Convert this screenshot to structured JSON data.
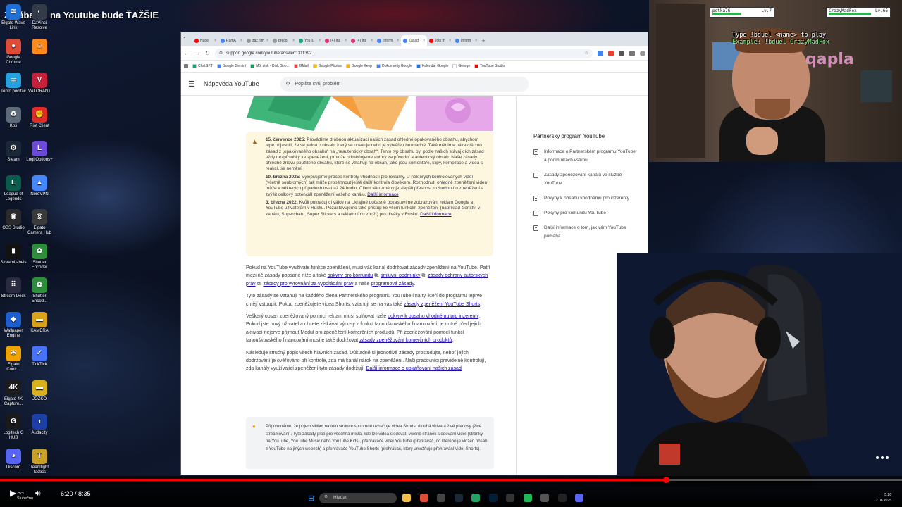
{
  "stream": {
    "title": "Zarábanie na Youtube bude ŤAŽŠIE"
  },
  "desktop_icons": [
    {
      "label": "Elgato Wave Link",
      "color": "#1e6fd6",
      "glyph": "≋"
    },
    {
      "label": "DaVinci Resolve",
      "color": "#333b48",
      "glyph": "◐"
    },
    {
      "label": "Google Chrome",
      "color": "#dd4b39",
      "glyph": "●"
    },
    {
      "label": "",
      "color": "#ff8a1c",
      "glyph": "☺"
    },
    {
      "label": "Tento počítač",
      "color": "#25a3e0",
      "glyph": "▭"
    },
    {
      "label": "VALORANT",
      "color": "#c81f3a",
      "glyph": "V"
    },
    {
      "label": "Koš",
      "color": "#5d6a7a",
      "glyph": "♻"
    },
    {
      "label": "Riot Client",
      "color": "#e02b2b",
      "glyph": "✊"
    },
    {
      "label": "Steam",
      "color": "#1b2838",
      "glyph": "⚙"
    },
    {
      "label": "Logi Options+",
      "color": "#6c4bd8",
      "glyph": "L"
    },
    {
      "label": "League of Legends",
      "color": "#0b5b4c",
      "glyph": "L"
    },
    {
      "label": "NordVPN",
      "color": "#4687ff",
      "glyph": "▲"
    },
    {
      "label": "OBS Studio",
      "color": "#2b2b2b",
      "glyph": "◉"
    },
    {
      "label": "Elgato Camera Hub",
      "color": "#3a3a3a",
      "glyph": "◎"
    },
    {
      "label": "StreamLabels",
      "color": "#121212",
      "glyph": "▮"
    },
    {
      "label": "Shutter Encoder",
      "color": "#2d8f3c",
      "glyph": "✿"
    },
    {
      "label": "Stream Deck",
      "color": "#2a2a40",
      "glyph": "⠿"
    },
    {
      "label": "Shutter Encod...",
      "color": "#2d8f3c",
      "glyph": "✿"
    },
    {
      "label": "Wallpaper Engine",
      "color": "#1e5fd0",
      "glyph": "◆"
    },
    {
      "label": "KAMERA",
      "color": "#d9a21b",
      "glyph": "▬"
    },
    {
      "label": "Elgato Contr...",
      "color": "#f0a200",
      "glyph": "☀"
    },
    {
      "label": "TickTick",
      "color": "#4772fa",
      "glyph": "✓"
    },
    {
      "label": "Elgato 4K Capture...",
      "color": "#1c1c1c",
      "glyph": "4K"
    },
    {
      "label": "JOZKO",
      "color": "#d9b21b",
      "glyph": "▬"
    },
    {
      "label": "Logitech G HUB",
      "color": "#1a1a1a",
      "glyph": "G"
    },
    {
      "label": "Audacity",
      "color": "#1c3fa8",
      "glyph": "◖"
    },
    {
      "label": "Discord",
      "color": "#5865f2",
      "glyph": "◕"
    },
    {
      "label": "Teamfight Tactics",
      "color": "#c8a028",
      "glyph": "T"
    }
  ],
  "browser": {
    "tabs": [
      {
        "label": "Huge",
        "color": "#ff0000"
      },
      {
        "label": "RamA",
        "color": "#4285f4"
      },
      {
        "label": "záž film",
        "color": "#999"
      },
      {
        "label": "prečo",
        "color": "#999"
      },
      {
        "label": "YouTu",
        "color": "#10a37f"
      },
      {
        "label": "(4) Ins",
        "color": "#e1306c"
      },
      {
        "label": "(4) Ins",
        "color": "#e1306c"
      },
      {
        "label": "Inform",
        "color": "#4285f4"
      },
      {
        "label": "Zásad",
        "color": "#4285f4",
        "active": true
      },
      {
        "label": "Join th",
        "color": "#ff0000"
      },
      {
        "label": "Inform",
        "color": "#4285f4"
      }
    ],
    "url": "support.google.com/youtube/answer/1311392",
    "bookmarks": [
      {
        "label": "ChatGPT",
        "color": "#10a37f"
      },
      {
        "label": "Google Gemini",
        "color": "#4285f4"
      },
      {
        "label": "Môj disk - Disk Goo...",
        "color": "#0f9d58"
      },
      {
        "label": "GMail",
        "color": "#ea4335"
      },
      {
        "label": "Google Photos",
        "color": "#fbbc05"
      },
      {
        "label": "Google Keep",
        "color": "#f4b400"
      },
      {
        "label": "Dokumenty Google",
        "color": "#4285f4"
      },
      {
        "label": "Kalendár Google",
        "color": "#1a73e8"
      },
      {
        "label": "George",
        "color": "#ffffff"
      },
      {
        "label": "YouTube Studio",
        "color": "#ff0000"
      }
    ],
    "help_title": "Nápověda YouTube",
    "search_placeholder": "Popište svůj problém"
  },
  "article": {
    "notice": {
      "u1_date": "15. července 2025:",
      "u1_text": " Provádíme drobnou aktualizaci našich zásad ohledně opakovaného obsahu, abychom lépe objasnili, že se jedná o obsah, který se opakuje nebo je vytvářen hromadně. Také měníme název těchto zásad z „opakovaného obsahu“ na „neautentický obsah“. Tento typ obsahu byl podle našich stávajících zásad vždy nezpůsobilý ke zpeněžení, protože odměňujeme autory za původní a autentický obsah. Naše zásady ohledně znovu použitého obsahu, které se vztahují na obsah, jako jsou komentáře, klipy, kompilace a videa s reakcí, se nemění.",
      "u2_date": "10. března 2025:",
      "u2_text": " Vylepšujeme proces kontroly vhodnosti pro reklamy. U některých kontrolovaných videí (včetně soukromých) tak může proběhnout ještě další kontrola člověkem. Rozhodnutí ohledně zpeněžení videa může v některých případech trvat až 24 hodin. Cílem této změny je zlepšit přesnost rozhodnutí o zpeněžení a zvýšit celkový potenciál zpeněžení vašeho kanálu.",
      "u2_link": "Další informace",
      "u3_date": "3. března 2022:",
      "u3_text": " Kvůli pokračující válce na Ukrajině dočasně pozastavíme zobrazování reklam Google a YouTube uživatelům v Rusku. Pozastavujeme také přístup ke všem funkcím zpeněžení (například členství v kanálu, Superchatu, Super Stickers a reklamnímu zboží) pro diváky v Rusku.",
      "u3_link": "Další informace"
    },
    "p1_a": "Pokud na YouTube využíváte funkce zpeněžení, musí váš kanál dodržovat zásady zpeněžení na YouTube. Patří mezi ně zásady popsané níže a také ",
    "p1_l1": "pokyny pro komunitu",
    "p1_b": " ⧉, ",
    "p1_l2": "smluvní podmínky",
    "p1_c": " ⧉, ",
    "p1_l3": "zásady ochrany autorských práv",
    "p1_d": " ⧉, ",
    "p1_l4": "zásady pro vyrovnání za vypořádání práv",
    "p1_e": " a naše ",
    "p1_l5": "programové zásady",
    "p1_f": ".",
    "p2_a": "Tyto zásady se vztahují na každého člena Partnerského programu YouTube i na ty, kteří do programu teprve chtějí vstoupit. Pokud zpeněžujete videa Shorts, vztahují se na vás také ",
    "p2_l": "zásady zpeněžení YouTube Shorts",
    "p2_b": ".",
    "p3_a": "Veškerý obsah zpeněžovaný pomocí reklam musí splňovat naše ",
    "p3_l1": "pokyny k obsahu vhodnému pro inzerenty",
    "p3_b": ". Pokud jste nový uživatel a chcete získávat výnosy z funkcí fanouškovského financování, je nutné před jejich aktivací nejprve přijmout Modul pro zpeněžení komerčních produktů. Při zpeněžování pomocí funkcí fanouškovského financování musíte také dodržovat ",
    "p3_l2": "zásady zpeněžování komerčních produktů",
    "p3_c": ".",
    "p4_a": "Následuje stručný popis všech hlavních zásad. Důkladně si jednotlivé zásady prostudujte, neboť jejich dodržování je ověřováno při kontrole, zda má kanál nárok na zpeněžení. Naši pracovníci pravidelně kontrolují, zda kanály využívající zpeněžení tyto zásady dodržují. ",
    "p4_l": "Další informace o uplatňování našich zásad",
    "tip_a": "Připomínáme, že pojem ",
    "tip_b": "video",
    "tip_c": " na této stránce souhrnně označuje videa Shorts, dlouhá videa a živé přenosy (živé streamování). Tyto zásady platí pro všechna místa, kde lze videa sledovat, včetně stránek sledování videí (stránky na YouTube, YouTube Music nebo YouTube Kids), přehrávače videí YouTube (přehrávač, do kterého je vložen obsah z YouTube na jiných webech) a přehrávače YouTube Shorts (přehrávač, který umožňuje přehrávání videí Shorts)."
  },
  "sidebar": {
    "title": "Partnerský program YouTube",
    "items": [
      "Informace o Partnerském programu YouTube a podmínkách vstupu",
      "Zásady zpeněžování kanálů ve službě YouTube",
      "Pokyny k obsahu vhodnému pro inzerenty",
      "Pokyny pro komunitu YouTube",
      "Další informace o tom, jak vám YouTube pomáhá"
    ]
  },
  "webcam": {
    "player1": "petka7G",
    "player1_level": "Lv.7",
    "player2": "CrazyMadFox",
    "player2_level": "Lv.66",
    "cmd_line1": "Type !bduel <name> to play",
    "cmd_line2": "Example: !bduel CrazyMadFox",
    "qapla": "qapla"
  },
  "player": {
    "current_time": "6:20",
    "duration": "8:35",
    "time_display": "6:20 / 8:35",
    "progress": 0.738
  },
  "taskbar": {
    "search_placeholder": "Hledat",
    "weather_temp": "25°C",
    "weather_desc": "Slunečno",
    "time": "5:26",
    "date": "12.08.2025",
    "apps": [
      {
        "name": "files-icon",
        "color": "#f2c04a"
      },
      {
        "name": "chrome-icon",
        "color": "#dd4b39"
      },
      {
        "name": "obs-icon",
        "color": "#444"
      },
      {
        "name": "steam-icon",
        "color": "#1b2838"
      },
      {
        "name": "edit-icon",
        "color": "#1fa463"
      },
      {
        "name": "photoshop-icon",
        "color": "#001e36"
      },
      {
        "name": "media-icon",
        "color": "#333"
      },
      {
        "name": "spotify-icon",
        "color": "#1db954"
      },
      {
        "name": "app-icon",
        "color": "#555"
      },
      {
        "name": "app2-icon",
        "color": "#222"
      },
      {
        "name": "discord-icon",
        "color": "#5865f2"
      }
    ]
  }
}
